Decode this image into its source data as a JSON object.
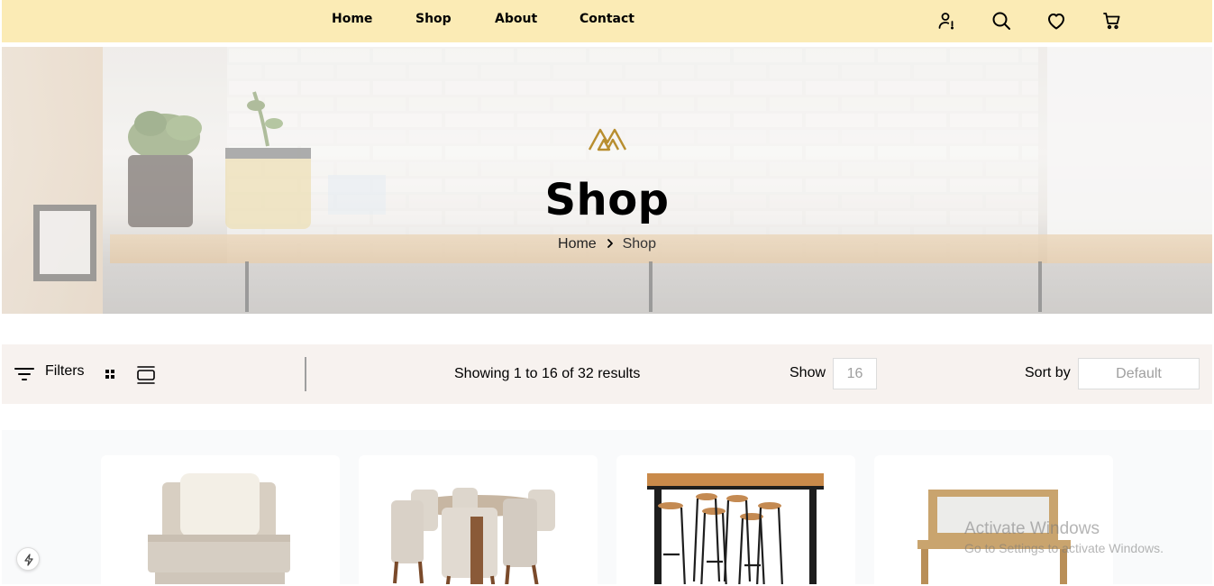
{
  "nav": {
    "links": [
      {
        "label": "Home"
      },
      {
        "label": "Shop"
      },
      {
        "label": "About"
      },
      {
        "label": "Contact"
      }
    ],
    "icons": [
      "user-alert-icon",
      "search-icon",
      "heart-icon",
      "cart-icon"
    ]
  },
  "hero": {
    "title": "Shop",
    "breadcrumb": {
      "home": "Home",
      "current": "Shop"
    },
    "logo_color": "#b88e2f"
  },
  "filter_bar": {
    "filter_label": "Filters",
    "results_text": "Showing 1 to 16 of 32 results",
    "show_label": "Show",
    "show_value": "16",
    "sort_label": "Sort by",
    "sort_value": "Default"
  },
  "products": [
    {
      "icon": "armchair-product-image"
    },
    {
      "icon": "dining-table-set-product-image"
    },
    {
      "icon": "bar-table-stools-product-image"
    },
    {
      "icon": "console-table-mirror-product-image"
    }
  ],
  "watermark": {
    "title": "Activate Windows",
    "subtitle": "Go to Settings to activate Windows."
  },
  "colors": {
    "navbar_bg": "#fbebb5",
    "filter_bar_bg": "#f7f2ef",
    "accent_gold": "#b88e2f"
  }
}
